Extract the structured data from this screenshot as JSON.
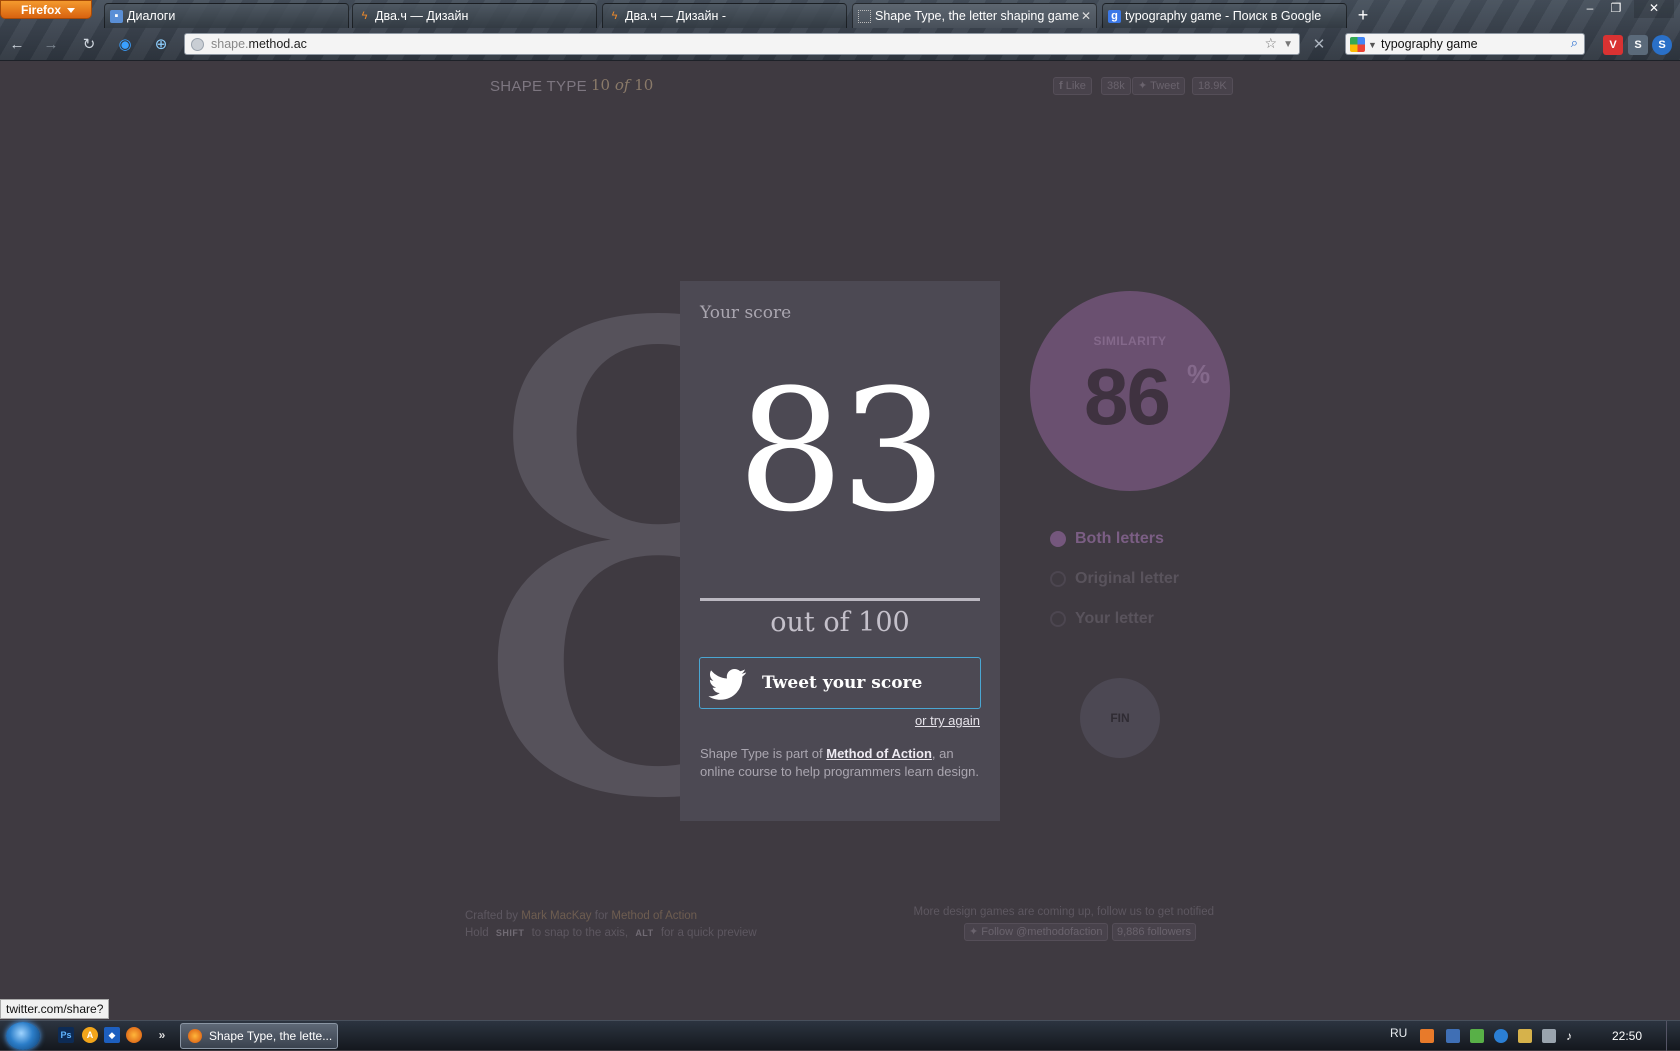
{
  "browser": {
    "app_button": "Firefox",
    "tabs": [
      {
        "label": "Диалоги",
        "icon": "chat-icon"
      },
      {
        "label": "Два.ч — Дизайн",
        "icon": "bolt-icon"
      },
      {
        "label": "Два.ч — Дизайн -",
        "icon": "bolt-icon"
      },
      {
        "label": "Shape Type, the letter shaping game",
        "icon": "page-icon",
        "active": true
      },
      {
        "label": "typography game - Поиск в Google",
        "icon": "google-icon"
      }
    ],
    "url_prefix": "shape.",
    "url_domain": "method.ac",
    "search_value": "typography game"
  },
  "page": {
    "brand": "SHAPE TYPE",
    "level_current": "10",
    "level_of": "of",
    "level_total": "10",
    "like_label": "Like",
    "like_count": "38k",
    "tweet_label": "Tweet",
    "tweet_count": "18.9K",
    "big_digit": "8",
    "score_card": {
      "label": "Your score",
      "score": "83",
      "out_of": "out of 100",
      "tweet_button": "Tweet your score",
      "try_again": "or try again",
      "about_prefix": "Shape Type is part of ",
      "about_link": "Method of Action",
      "about_suffix": ", an online course to help programmers learn design."
    },
    "similarity": {
      "label": "SIMILARITY",
      "value": "86",
      "unit": "%"
    },
    "view_options": [
      {
        "label": "Both letters",
        "selected": true
      },
      {
        "label": "Original letter",
        "selected": false
      },
      {
        "label": "Your letter",
        "selected": false
      }
    ],
    "fin_button": "FIN",
    "footer": {
      "crafted_prefix": "Crafted by",
      "crafted_author": "Mark MacKay",
      "crafted_mid": "for",
      "crafted_org": "Method of Action",
      "hold": "Hold",
      "shift_key": "SHIFT",
      "shift_text": "to snap to the axis,",
      "alt_key": "ALT",
      "alt_text": "for a quick preview",
      "games_note": "More design games are coming up, follow us to get notified",
      "follow_button": "Follow @methodofaction",
      "followers": "9,886 followers"
    }
  },
  "status_tip": "twitter.com/share?",
  "taskbar": {
    "active_window": "Shape Type, the lette...",
    "language": "RU",
    "clock": "22:50"
  },
  "colors": {
    "page_bg": "#3f3a41",
    "card_bg": "#4c4953",
    "similarity_circle": "#6a5070",
    "twitter_border": "#4aa6d2"
  }
}
